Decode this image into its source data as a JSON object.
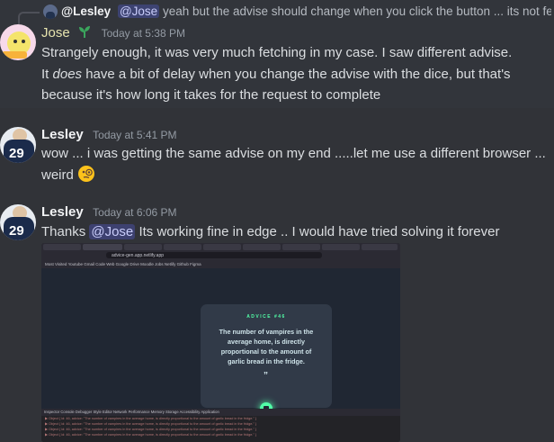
{
  "reply": {
    "author": "@Lesley",
    "mention": "@Jose",
    "text": "yeah but the advise should change when you click the button ... its not fetc..."
  },
  "messages": [
    {
      "author": "Jose",
      "timestamp": "Today at 5:38 PM",
      "line1": "Strangely enough, it was very much fetching in my case. I saw different advise.",
      "line2_a": "It ",
      "line2_em": "does",
      "line2_b": " have a bit of delay when you change the advise with the dice, but that's",
      "line3": "because it's how long it takes for the request to complete"
    },
    {
      "author": "Lesley",
      "timestamp": "Today at 5:41 PM",
      "line1": "wow ... i was getting the same advise on my end .....let me use a different browser ...",
      "line2": "weird",
      "emoji": "monocle-face"
    },
    {
      "author": "Lesley",
      "timestamp": "Today at 6:06 PM",
      "text_a": "Thanks ",
      "mention": "@Jose",
      "text_b": " Its working fine in edge .. I would have tried solving it forever"
    }
  ],
  "avatar_number": "29",
  "screenshot": {
    "url": "advice-gen.app.netlify.app",
    "advice_label": "ADVICE #46",
    "advice_text": "The number of vampires in the average home, is directly proportional to the amount of garlic bread in the fridge.",
    "quote_mark": "”",
    "bookmarks": "Most Visited   Youtube   Gmail   Code   Web   Google Drive   Moodle   Jobs   Netlify   Github   Figma",
    "devtools": "Inspector   Console   Debugger   Style Editor   Network   Performance   Memory   Storage   Accessibility   Application",
    "console_lines": [
      "▶ Object { id: 46, advice: \"The number of vampires in the average home, is directly proportional to the amount of garlic bread in the fridge.\" }",
      "▶ Object { id: 46, advice: \"The number of vampires in the average home, is directly proportional to the amount of garlic bread in the fridge.\" }",
      "▶ Object { id: 46, advice: \"The number of vampires in the average home, is directly proportional to the amount of garlic bread in the fridge.\" }",
      "▶ Object { id: 46, advice: \"The number of vampires in the average home, is directly proportional to the amount of garlic bread in the fridge.\" }"
    ]
  },
  "colors": {
    "background": "#313338",
    "mention_bg": "#3c4270",
    "jose_name": "#e7e4ae",
    "advice_green": "#52ffa8"
  }
}
